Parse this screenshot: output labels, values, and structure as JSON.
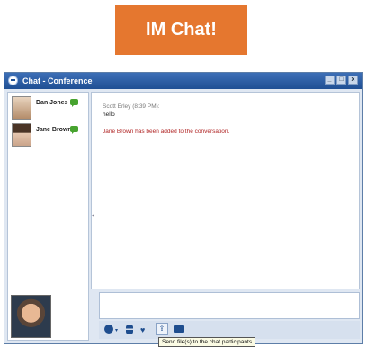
{
  "banner": {
    "label": "IM Chat!"
  },
  "window": {
    "title": "Chat - Conference",
    "controls": [
      "_",
      "□",
      "x"
    ]
  },
  "participants": [
    {
      "name": "Dan Jones"
    },
    {
      "name": "Jane Brown"
    }
  ],
  "conversation": {
    "sender_line": "Scott Erley (8:39 PM):",
    "message": "hello",
    "system_message": "Jane Brown has been added to the conversation."
  },
  "input": {
    "value": ""
  },
  "toolbar": {
    "icons": [
      "emoticon-icon",
      "chevron-down-icon",
      "user-icon",
      "heart-icon",
      "send-file-icon",
      "folder-icon"
    ]
  },
  "tooltip": {
    "text": "Send file(s) to the chat participants"
  },
  "colors": {
    "banner": "#e5772f",
    "titlebar": "#1f4f94",
    "system_message": "#b02424"
  }
}
